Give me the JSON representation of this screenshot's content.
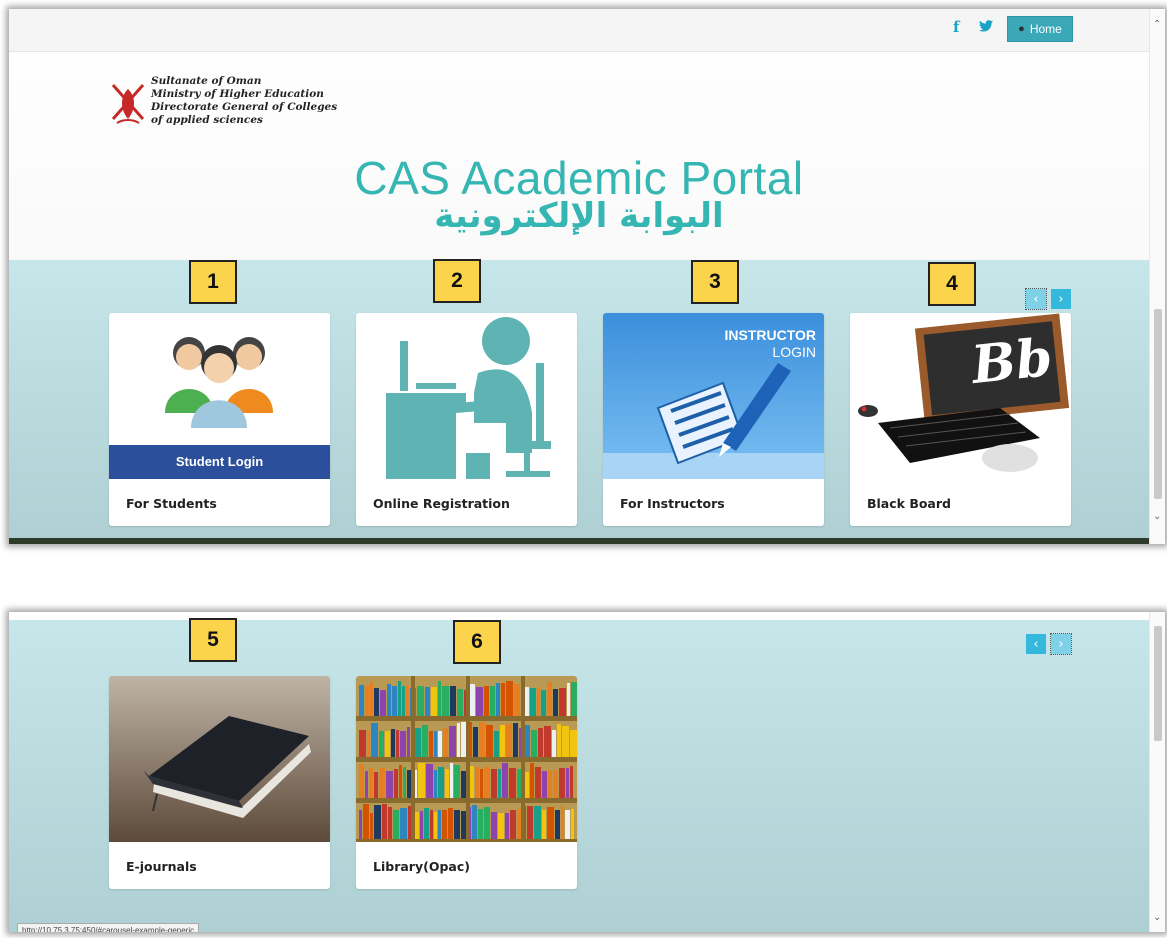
{
  "topbar": {
    "facebook_icon": "f",
    "twitter_icon": "🐦",
    "home_label": "Home"
  },
  "logo": {
    "lines": [
      "Sultanate of Oman",
      "Ministry of Higher Education",
      "Directorate General of Colleges",
      "of applied sciences"
    ]
  },
  "title": {
    "english": "CAS Academic Portal",
    "arabic": "البوابة الإلكترونية"
  },
  "cards_row1": [
    {
      "badge": "1",
      "caption": "For Students",
      "image_text": "Student Login"
    },
    {
      "badge": "2",
      "caption": "Online Registration"
    },
    {
      "badge": "3",
      "caption": "For Instructors",
      "image_text": [
        "INSTRUCTOR",
        "LOGIN"
      ]
    },
    {
      "badge": "4",
      "caption": "Black Board",
      "image_text": "Bb"
    }
  ],
  "cards_row2": [
    {
      "badge": "5",
      "caption": "E-journals"
    },
    {
      "badge": "6",
      "caption": "Library(Opac)"
    }
  ],
  "carousel": {
    "prev": "‹",
    "next": "›"
  },
  "status_url": "http://10.75.3.75:450/#carousel-example-generic",
  "colors": {
    "accent": "#35b6b2",
    "band": "#c6e6e9",
    "badge": "#fbd44c",
    "nav": "#34b8dc"
  }
}
